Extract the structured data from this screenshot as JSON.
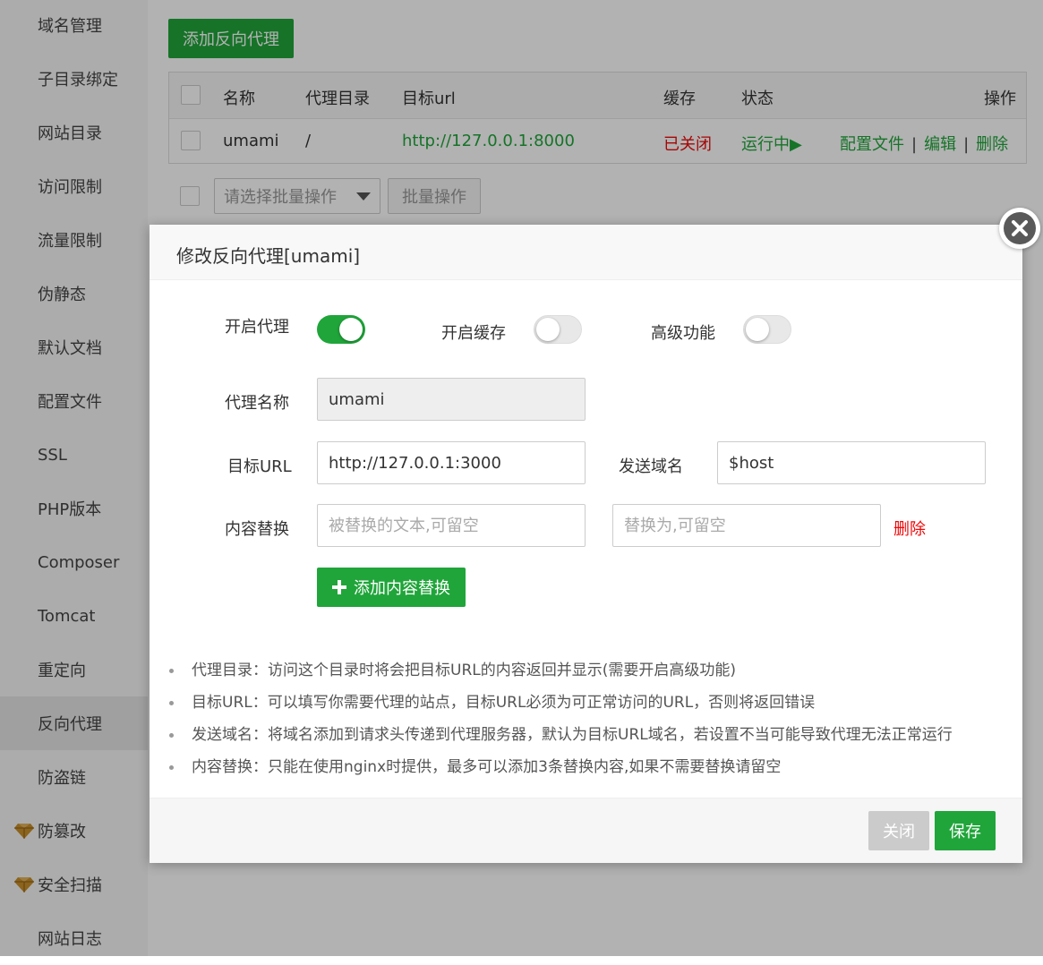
{
  "sidebar": {
    "items": [
      {
        "label": "域名管理"
      },
      {
        "label": "子目录绑定"
      },
      {
        "label": "网站目录"
      },
      {
        "label": "访问限制"
      },
      {
        "label": "流量限制"
      },
      {
        "label": "伪静态"
      },
      {
        "label": "默认文档"
      },
      {
        "label": "配置文件"
      },
      {
        "label": "SSL"
      },
      {
        "label": "PHP版本"
      },
      {
        "label": "Composer"
      },
      {
        "label": "Tomcat"
      },
      {
        "label": "重定向"
      },
      {
        "label": "反向代理",
        "active": true
      },
      {
        "label": "防盗链"
      },
      {
        "label": "防篡改",
        "icon": "gem-icon"
      },
      {
        "label": "安全扫描",
        "icon": "gem-icon"
      },
      {
        "label": "网站日志"
      }
    ]
  },
  "main": {
    "add_button": "添加反向代理",
    "table": {
      "headers": {
        "name": "名称",
        "dir": "代理目录",
        "url": "目标url",
        "cache": "缓存",
        "status": "状态",
        "ops": "操作"
      },
      "rows": [
        {
          "name": "umami",
          "dir": "/",
          "url": "http://127.0.0.1:8000",
          "cache": "已关闭",
          "status": "运行中▶",
          "op_config": "配置文件",
          "op_edit": "编辑",
          "op_delete": "删除",
          "sep": "|"
        }
      ]
    },
    "batch": {
      "placeholder": "请选择批量操作",
      "button": "批量操作"
    }
  },
  "modal": {
    "title": "修改反向代理[umami]",
    "toggles": {
      "proxy": {
        "label": "开启代理",
        "on": true
      },
      "cache": {
        "label": "开启缓存",
        "on": false
      },
      "advanced": {
        "label": "高级功能",
        "on": false
      }
    },
    "proxy_name": {
      "label": "代理名称",
      "value": "umami"
    },
    "target_url": {
      "label": "目标URL",
      "value": "http://127.0.0.1:3000"
    },
    "send_domain": {
      "label": "发送域名",
      "value": "$host"
    },
    "content_replace": {
      "label": "内容替换",
      "from_placeholder": "被替换的文本,可留空",
      "to_placeholder": "替换为,可留空",
      "delete": "删除"
    },
    "add_replace_button": "添加内容替换",
    "tips": [
      "代理目录：访问这个目录时将会把目标URL的内容返回并显示(需要开启高级功能)",
      "目标URL：可以填写你需要代理的站点，目标URL必须为可正常访问的URL，否则将返回错误",
      "发送域名：将域名添加到请求头传递到代理服务器，默认为目标URL域名，若设置不当可能导致代理无法正常运行",
      "内容替换：只能在使用nginx时提供，最多可以添加3条替换内容,如果不需要替换请留空"
    ],
    "close_button": "关闭",
    "save_button": "保存"
  },
  "colors": {
    "accent": "#20a53a",
    "danger": "#ef0808",
    "gem": "#c8902a"
  }
}
